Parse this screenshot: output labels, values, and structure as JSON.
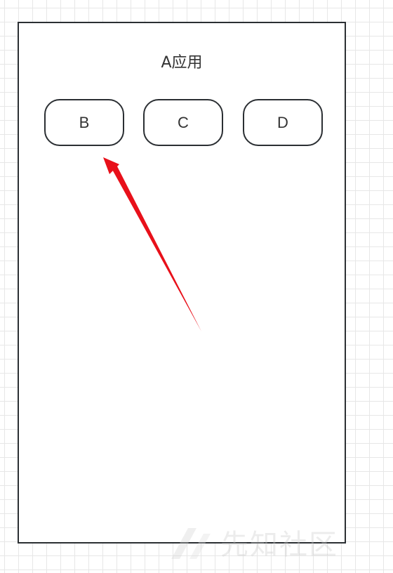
{
  "app": {
    "title": "A应用",
    "buttons": [
      {
        "label": "B"
      },
      {
        "label": "C"
      },
      {
        "label": "D"
      }
    ]
  },
  "watermark": {
    "text": "先知社区"
  },
  "colors": {
    "frame": "#2b2f33",
    "arrow": "#e8101a",
    "grid": "#e7e7e7"
  }
}
